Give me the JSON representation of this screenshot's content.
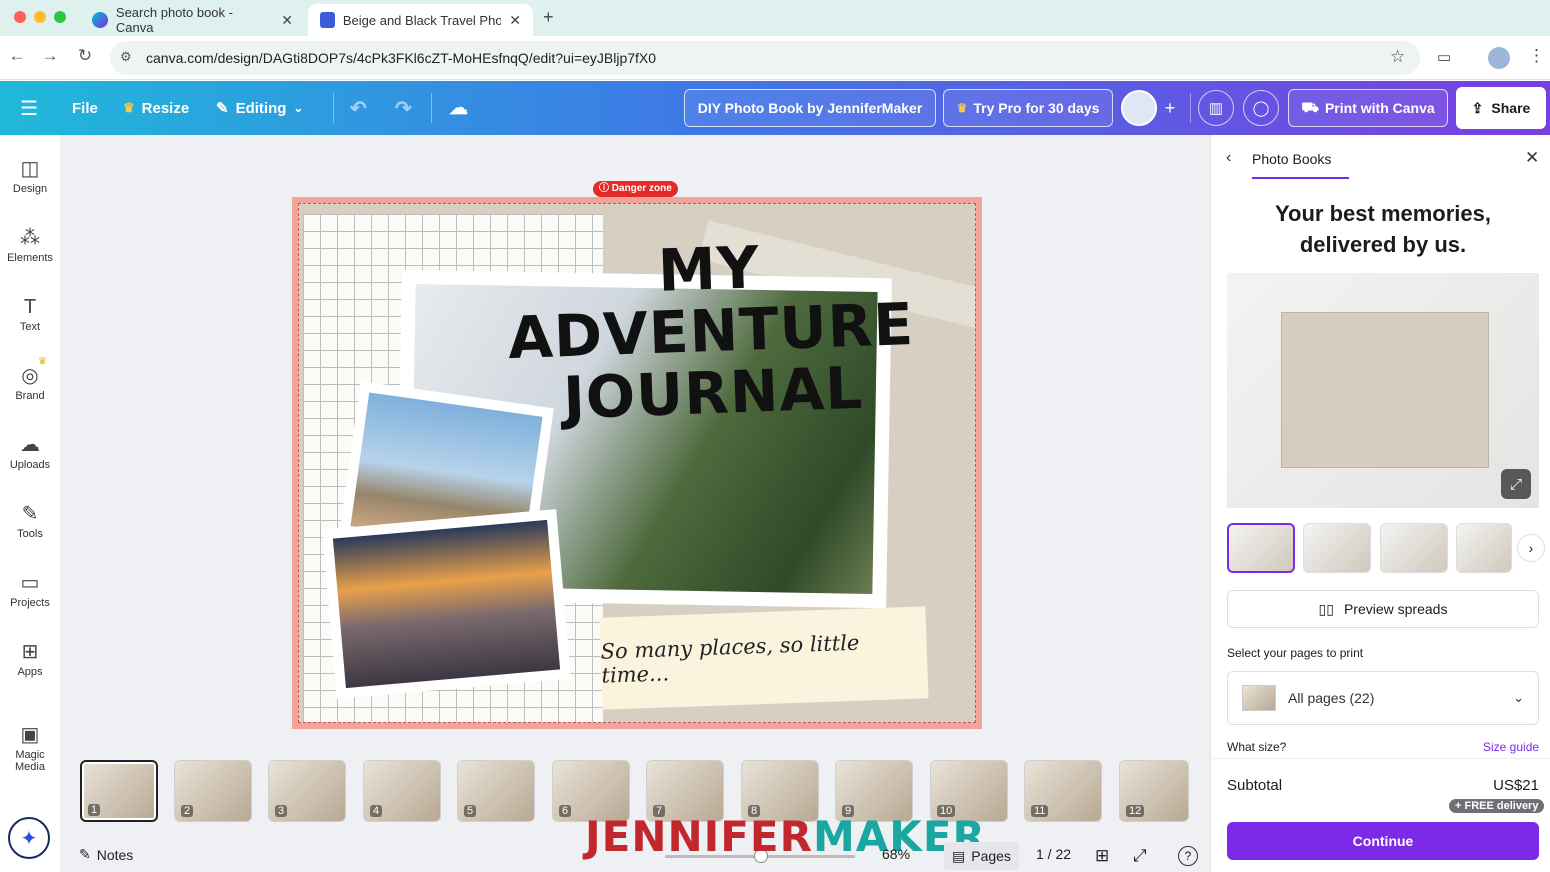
{
  "browser": {
    "tabs": [
      {
        "title": "Search photo book - Canva",
        "active": false
      },
      {
        "title": "Beige and Black Travel Photo",
        "active": true
      }
    ],
    "url": "canva.com/design/DAGti8DOP7s/4cPk3FKl6cZT-MoHEsfnqQ/edit?ui=eyJBljp7fX0"
  },
  "header": {
    "file": "File",
    "resize": "Resize",
    "editing": "Editing",
    "design_title": "DIY Photo Book by JenniferMaker",
    "try_pro": "Try Pro for 30 days",
    "print": "Print with Canva",
    "share": "Share"
  },
  "sidebar": {
    "items": [
      {
        "label": "Design",
        "icon": "design-icon"
      },
      {
        "label": "Elements",
        "icon": "elements-icon"
      },
      {
        "label": "Text",
        "icon": "text-icon"
      },
      {
        "label": "Brand",
        "icon": "brand-icon"
      },
      {
        "label": "Uploads",
        "icon": "uploads-icon"
      },
      {
        "label": "Tools",
        "icon": "tools-icon"
      },
      {
        "label": "Projects",
        "icon": "projects-icon"
      },
      {
        "label": "Apps",
        "icon": "apps-icon"
      },
      {
        "label": "Magic Media",
        "icon": "magic-media-icon"
      }
    ]
  },
  "canvas": {
    "danger": "Danger zone",
    "title_line1": "MY ADVENTURE",
    "title_line2": "JOURNAL",
    "caption": "So many places, so little time..."
  },
  "thumbnails": [
    "1",
    "2",
    "3",
    "4",
    "5",
    "6",
    "7",
    "8",
    "9",
    "10",
    "11",
    "12"
  ],
  "bottom": {
    "notes": "Notes",
    "watermark_a": "JENNIFER",
    "watermark_b": "MAKER",
    "zoom": "68%",
    "pages": "Pages",
    "page_count": "1 / 22"
  },
  "panel": {
    "tab": "Photo Books",
    "headline_1": "Your best memories,",
    "headline_2": "delivered by us.",
    "preview_spreads": "Preview spreads",
    "select_label": "Select your pages to print",
    "select_value": "All pages (22)",
    "size_label": "What size?",
    "size_guide": "Size guide",
    "subtotal_label": "Subtotal",
    "subtotal_value": "US$21",
    "free_delivery": "+ FREE delivery",
    "continue": "Continue"
  },
  "colors": {
    "accent": "#7d2ae8",
    "danger": "#e52a2a",
    "watermark_red": "#c1272d",
    "watermark_teal": "#1aa7a1"
  }
}
